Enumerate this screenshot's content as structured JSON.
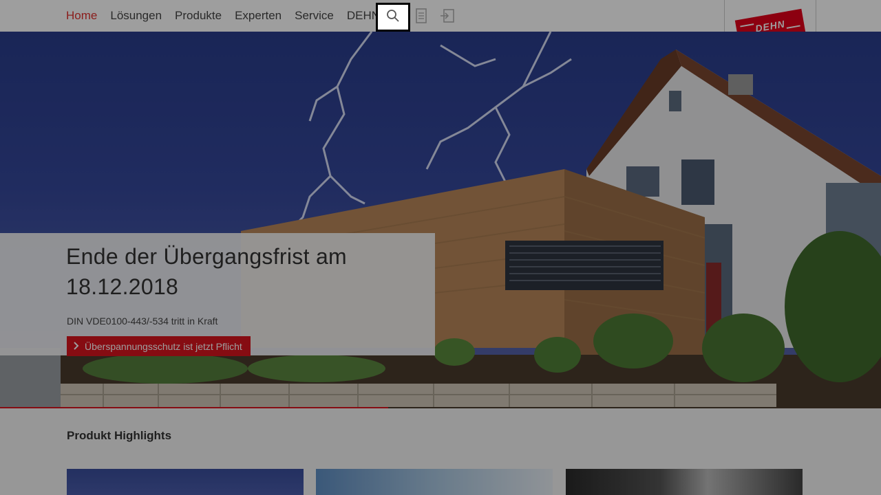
{
  "nav": {
    "items": [
      {
        "label": "Home",
        "active": true
      },
      {
        "label": "Lösungen"
      },
      {
        "label": "Produkte"
      },
      {
        "label": "Experten"
      },
      {
        "label": "Service"
      },
      {
        "label": "DEHN"
      }
    ],
    "icons": [
      "search-icon",
      "document-icon",
      "login-icon"
    ]
  },
  "logo": {
    "text": "DEHN"
  },
  "hero": {
    "title": "Ende der Übergangsfrist am 18.12.2018",
    "subtitle": "DIN VDE0100-443/-534 tritt in Kraft",
    "button": "Überspannungsschutz ist jetzt Pflicht"
  },
  "highlights": {
    "title": "Produkt Highlights"
  },
  "colors": {
    "accent": "#d8141e",
    "nav_active": "#e0312e",
    "brand_red": "#e2001a"
  }
}
